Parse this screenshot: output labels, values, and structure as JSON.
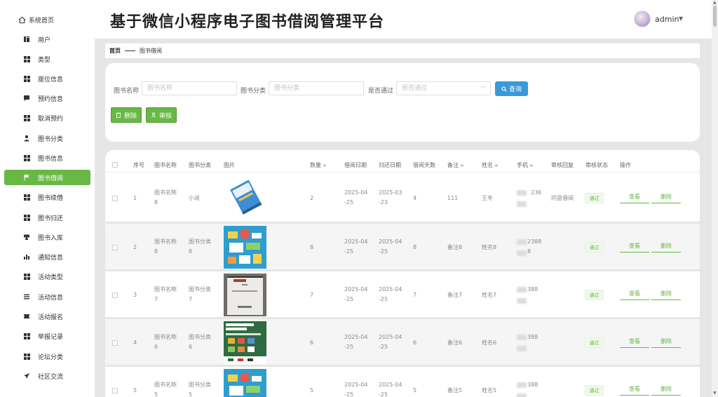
{
  "site": {
    "title": "基于微信小程序电子图书借阅管理平台"
  },
  "user": {
    "name": "admin",
    "caret": "▼"
  },
  "sidebar": {
    "items": [
      {
        "label": "系统首页",
        "icon": "home-icon"
      },
      {
        "label": "用户",
        "icon": "book-icon"
      },
      {
        "label": "类型",
        "icon": "grid-icon"
      },
      {
        "label": "座位信息",
        "icon": "grid-icon"
      },
      {
        "label": "预约信息",
        "icon": "chat-icon"
      },
      {
        "label": "取消预约",
        "icon": "grid-icon"
      },
      {
        "label": "图书分类",
        "icon": "person-icon"
      },
      {
        "label": "图书信息",
        "icon": "grid-icon"
      },
      {
        "label": "图书借阅",
        "icon": "flag-icon",
        "active": true
      },
      {
        "label": "图书续借",
        "icon": "grid-icon"
      },
      {
        "label": "图书归还",
        "icon": "grid-icon"
      },
      {
        "label": "图书入库",
        "icon": "cup-icon"
      },
      {
        "label": "通知信息",
        "icon": "bar-chart-icon"
      },
      {
        "label": "活动类型",
        "icon": "grid-icon"
      },
      {
        "label": "活动信息",
        "icon": "list-icon"
      },
      {
        "label": "活动报名",
        "icon": "ticket-icon"
      },
      {
        "label": "举报记录",
        "icon": "grid-icon"
      },
      {
        "label": "论坛分类",
        "icon": "grid-icon"
      },
      {
        "label": "社区交流",
        "icon": "send-icon"
      }
    ]
  },
  "breadcrumb": {
    "home": "首页",
    "current": "图书借阅"
  },
  "search": {
    "book_name_label": "图书名称",
    "book_name_placeholder": "图书名称",
    "category_label": "图书分类",
    "category_placeholder": "图书分类",
    "approved_label": "是否通过",
    "approved_placeholder": "是否通过",
    "query_label": "查询",
    "delete_label": "删除",
    "review_label": "审核"
  },
  "table": {
    "columns": {
      "index": "序号",
      "book_name": "图书名称",
      "category": "图书分类",
      "image": "图片",
      "quantity": "数量",
      "borrow_date": "借阅日期",
      "return_date": "归还日期",
      "borrow_days": "借阅天数",
      "remark": "备注",
      "name": "姓名",
      "phone": "手机",
      "review_reply": "审核回复",
      "review_status": "审核状态",
      "actions": "操作"
    },
    "sort_icon": "≑",
    "view_label": "查看",
    "delete_label": "删除",
    "rows": [
      {
        "index": "1",
        "book_name": "图书名称8",
        "category": "小说",
        "quantity": "2",
        "borrow_date": "2025-04-25",
        "return_date": "2025-03-23",
        "borrow_days": "4",
        "remark": "111",
        "name": "王冬",
        "phone": "236",
        "reply": "同意借阅",
        "status": "通过"
      },
      {
        "index": "2",
        "book_name": "图书名称8",
        "category": "图书分类8",
        "quantity": "8",
        "borrow_date": "2025-04-25",
        "return_date": "2025-04-25",
        "borrow_days": "8",
        "remark": "备注8",
        "name": "姓名8",
        "phone": "2388",
        "phone2": "8",
        "reply": "",
        "status": "通过"
      },
      {
        "index": "3",
        "book_name": "图书名称7",
        "category": "图书分类7",
        "quantity": "7",
        "borrow_date": "2025-04-25",
        "return_date": "2025-04-25",
        "borrow_days": "7",
        "remark": "备注7",
        "name": "姓名7",
        "phone": "388",
        "reply": "",
        "status": "通过"
      },
      {
        "index": "4",
        "book_name": "图书名称6",
        "category": "图书分类6",
        "quantity": "6",
        "borrow_date": "2025-04-25",
        "return_date": "2025-04-25",
        "borrow_days": "6",
        "remark": "备注6",
        "name": "姓名6",
        "phone": "388",
        "reply": "",
        "status": "通过"
      },
      {
        "index": "5",
        "book_name": "图书名称5",
        "category": "图书分类5",
        "quantity": "5",
        "borrow_date": "2025-04-25",
        "return_date": "2025-04-25",
        "borrow_days": "5",
        "remark": "备注5",
        "name": "姓名5",
        "phone": "388",
        "reply": "",
        "status": "通过"
      }
    ]
  },
  "colors": {
    "accent": "#67b845",
    "query": "#3a9ad9"
  }
}
